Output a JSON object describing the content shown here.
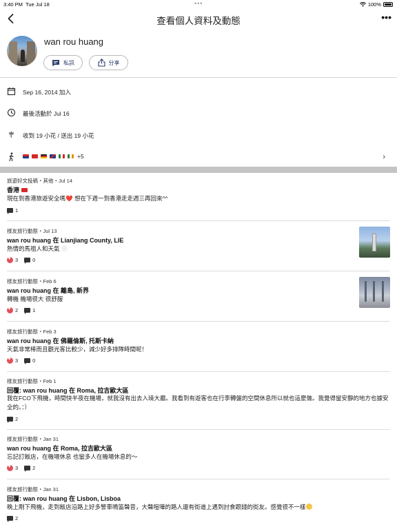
{
  "status_bar": {
    "time": "3:40 PM",
    "date": "Tue Jul 18",
    "dots": "•••",
    "battery": "100%"
  },
  "nav": {
    "title": "查看個人資料及動態",
    "more_glyph": "•••"
  },
  "profile": {
    "name": "wan rou huang",
    "message_label": "私訊",
    "share_label": "分享"
  },
  "info": {
    "joined": "Sep 16, 2014 加入",
    "last_active": "最後活動於 Jul 16",
    "flowers": "收到 19 小花 / 送出 19 小花",
    "flags_more": "+5",
    "flag_colors": [
      "#1f3a8a",
      "#d62828",
      "#222222",
      "#b3202e",
      "#2e7d32",
      "#ef8a17"
    ]
  },
  "posts": [
    {
      "meta": "旅遊好文投稿・其他・Jul 14",
      "headline": "香港",
      "body": "現在到香港旅遊安全嗎❤️ 想在下週一到香港走走週三再回來^^",
      "likes": null,
      "comments": "1"
    },
    {
      "meta": "樣友旅行動態・Jul 13",
      "headline": "wan rou huang 在 Lianjiang County, LIE",
      "body": "熱情的馬祖人和天氣",
      "likes": "3",
      "comments": "0"
    },
    {
      "meta": "樣友旅行動態・Feb 6",
      "headline": "wan rou huang 在 離島, 新界",
      "body": "轉機 機場很大 很舒服",
      "likes": "2",
      "comments": "1"
    },
    {
      "meta": "樣友旅行動態・Feb 3",
      "headline": "wan rou huang 在 佛羅倫斯, 托斯卡納",
      "body": "天氣非常棒而且觀光客比較少，減少好多排隊時間呢！",
      "likes": "3",
      "comments": "0"
    },
    {
      "meta": "樣友旅行動態・Feb 1",
      "headline": "回覆: wan rou huang 在 Roma, 拉吉歐大區",
      "body": "我在FCO下飛機，時間快半夜在機場，就我沒有出去入境大廳。我看到有遊客也在行李轉盤的空間休息所以就也這麼做。我覺得蠻安靜的地方也據安全的。：）",
      "likes": null,
      "comments": "2"
    },
    {
      "meta": "樣友旅行動態・Jan 31",
      "headline": "wan rou huang 在 Roma, 拉吉歐大區",
      "body": "忘記訂飯店，在機場休息 也蠻多人在機場休息的～",
      "likes": "3",
      "comments": "2"
    },
    {
      "meta": "樣友旅行動態・Jan 31",
      "headline": "回覆: wan rou huang 在 Lisbon, Lisboa",
      "body": "晚上剛下飛機，走到飯店沿路上好多警車鳴笛聲音，大聲喧嘩的路人還有街道上遇到討食跟錢的街友。感覺很不一樣",
      "likes": null,
      "comments": "2"
    }
  ]
}
